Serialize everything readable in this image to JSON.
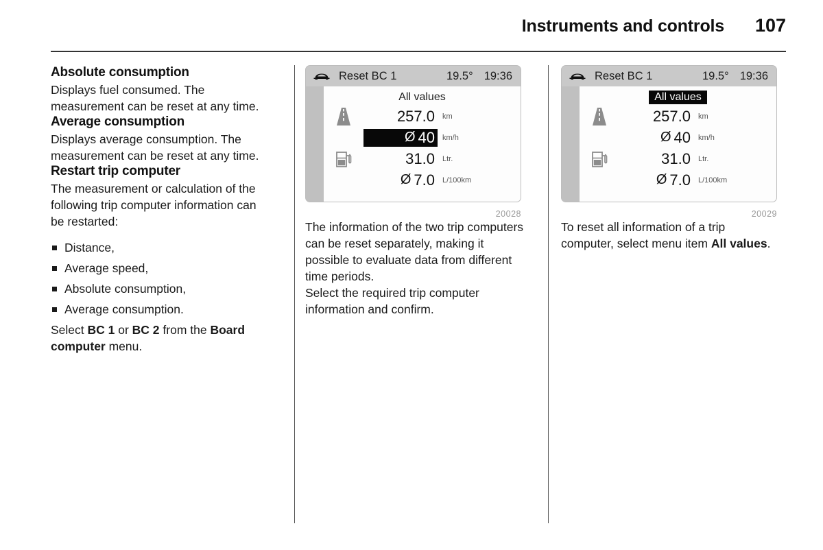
{
  "header": {
    "title": "Instruments and controls",
    "page_number": "107"
  },
  "left_column": {
    "sections": [
      {
        "heading": "Absolute consumption",
        "paragraph": "Displays fuel consumed. The measurement can be reset at any time."
      },
      {
        "heading": "Average consumption",
        "paragraph": "Displays average consumption. The measurement can be reset at any time."
      }
    ],
    "restart_section": {
      "heading": "Restart trip computer",
      "intro": "The measurement or calculation of the following trip computer information can be restarted:",
      "bullets": [
        "Distance,",
        "Average speed,",
        "Absolute consumption,",
        "Average consumption."
      ],
      "closing": {
        "part1": "Select ",
        "bold1": "BC 1",
        "part2": " or ",
        "bold2": "BC 2",
        "part3": " from the ",
        "bold3": "Board computer",
        "part4": " menu."
      }
    }
  },
  "middle_column": {
    "figure": {
      "caption": "20028",
      "display": {
        "car_icon": "car-icon",
        "title": "Reset BC 1",
        "temperature": "19.5°",
        "clock": "19:36",
        "menu_title": "All values",
        "menu_title_selected": false,
        "rows": [
          {
            "icon": "road-icon",
            "avg": "",
            "value": "257.0",
            "unit": "km",
            "selected": false
          },
          {
            "icon": "",
            "avg": "Ø",
            "value": "40",
            "unit": "km/h",
            "selected": true
          },
          {
            "icon": "fuel-icon",
            "avg": "",
            "value": "31.0",
            "unit": "Ltr.",
            "selected": false
          },
          {
            "icon": "",
            "avg": "Ø",
            "value": "7.0",
            "unit": "L/100km",
            "selected": false
          }
        ]
      }
    },
    "paragraphs": [
      "The information of the two trip computers can be reset separately, making it possible to evaluate data from different time periods.",
      "Select the required trip computer information and confirm."
    ]
  },
  "right_column": {
    "figure": {
      "caption": "20029",
      "display": {
        "car_icon": "car-icon",
        "title": "Reset BC 1",
        "temperature": "19.5°",
        "clock": "19:36",
        "menu_title": "All values",
        "menu_title_selected": true,
        "rows": [
          {
            "icon": "road-icon",
            "avg": "",
            "value": "257.0",
            "unit": "km",
            "selected": false
          },
          {
            "icon": "",
            "avg": "Ø",
            "value": "40",
            "unit": "km/h",
            "selected": false
          },
          {
            "icon": "fuel-icon",
            "avg": "",
            "value": "31.0",
            "unit": "Ltr.",
            "selected": false
          },
          {
            "icon": "",
            "avg": "Ø",
            "value": "7.0",
            "unit": "L/100km",
            "selected": false
          }
        ]
      }
    },
    "paragraph": {
      "part1": "To reset all information of a trip computer, select menu item ",
      "bold1": "All values",
      "part2": "."
    }
  },
  "colors": {
    "display_header_bg": "#c9c9c9",
    "display_sidebar_bg": "#c0c0c0",
    "display_screen_bg": "#fdfdfd",
    "highlight_bg": "#080808",
    "highlight_fg": "#ffffff",
    "caption_text": "#9a9a9a",
    "rule": "#333333"
  }
}
